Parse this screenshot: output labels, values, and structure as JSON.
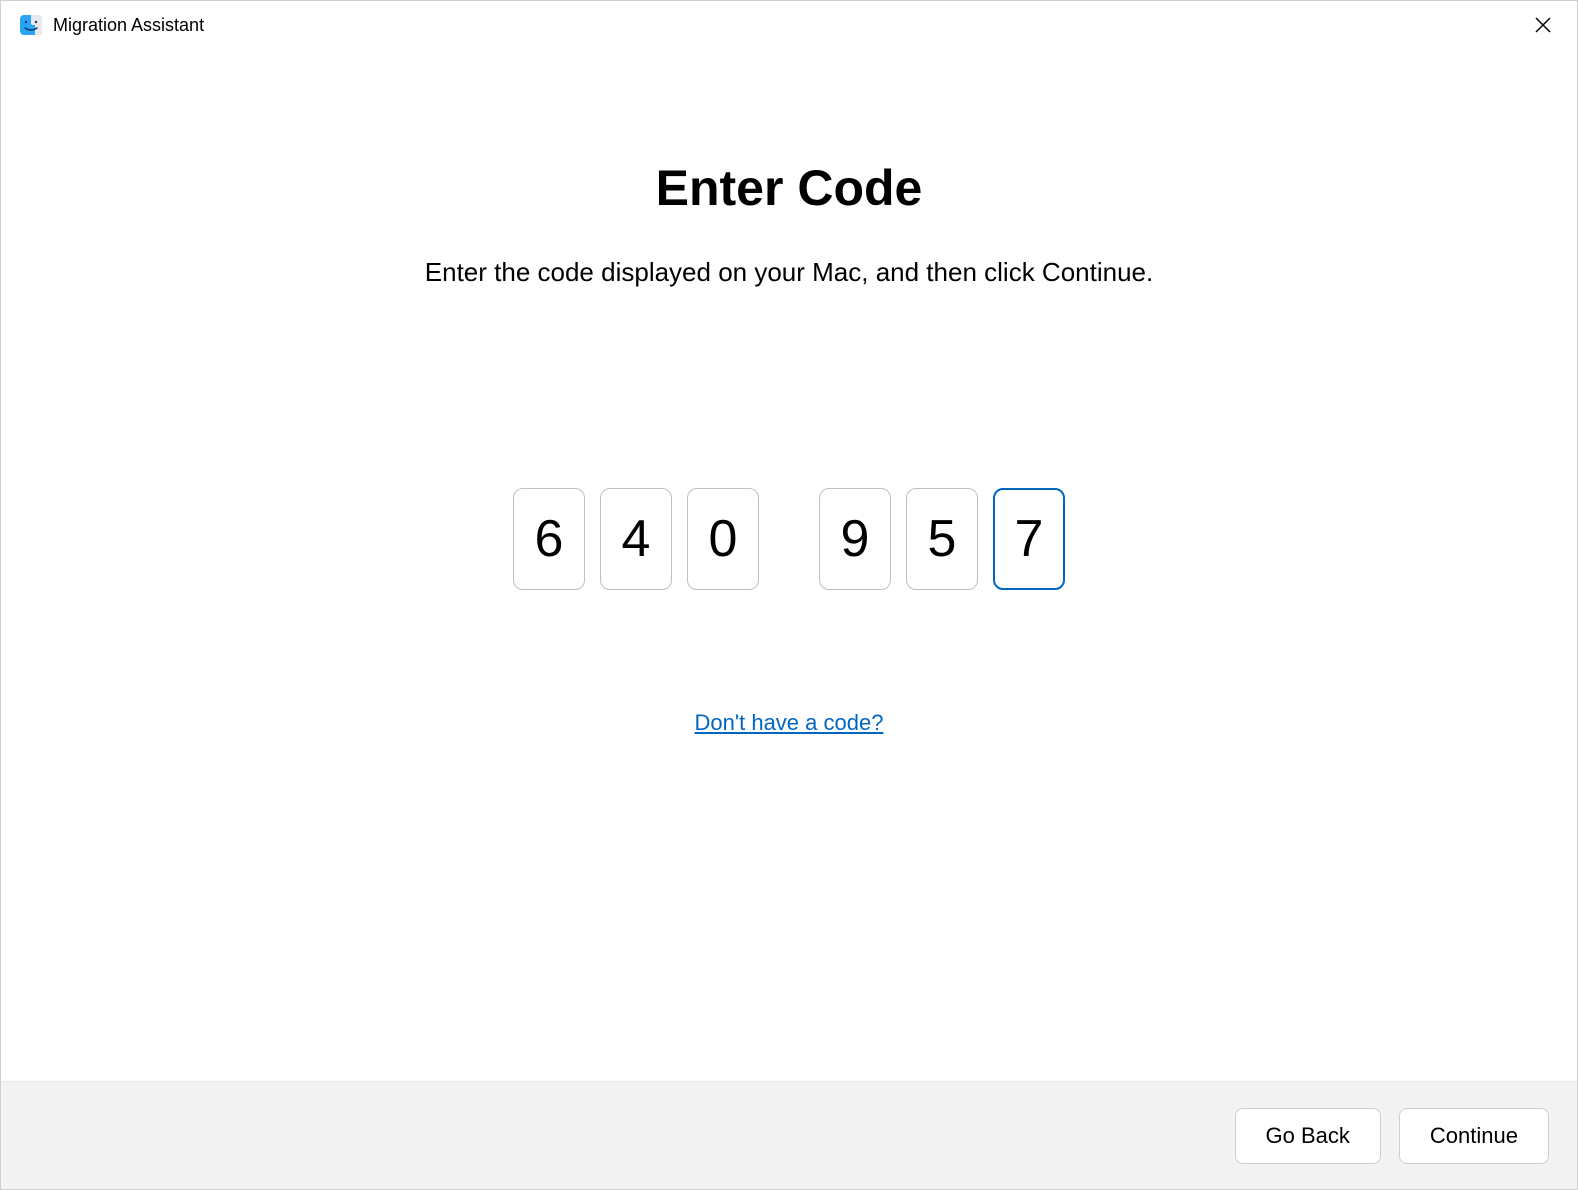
{
  "app": {
    "title": "Migration Assistant",
    "icon_name": "finder-icon"
  },
  "main": {
    "heading": "Enter Code",
    "subtitle": "Enter the code displayed on your Mac, and then click Continue.",
    "code_digits": [
      "6",
      "4",
      "0",
      "9",
      "5",
      "7"
    ],
    "active_index": 5,
    "help_link": "Don't have a code?"
  },
  "footer": {
    "go_back_label": "Go Back",
    "continue_label": "Continue"
  }
}
